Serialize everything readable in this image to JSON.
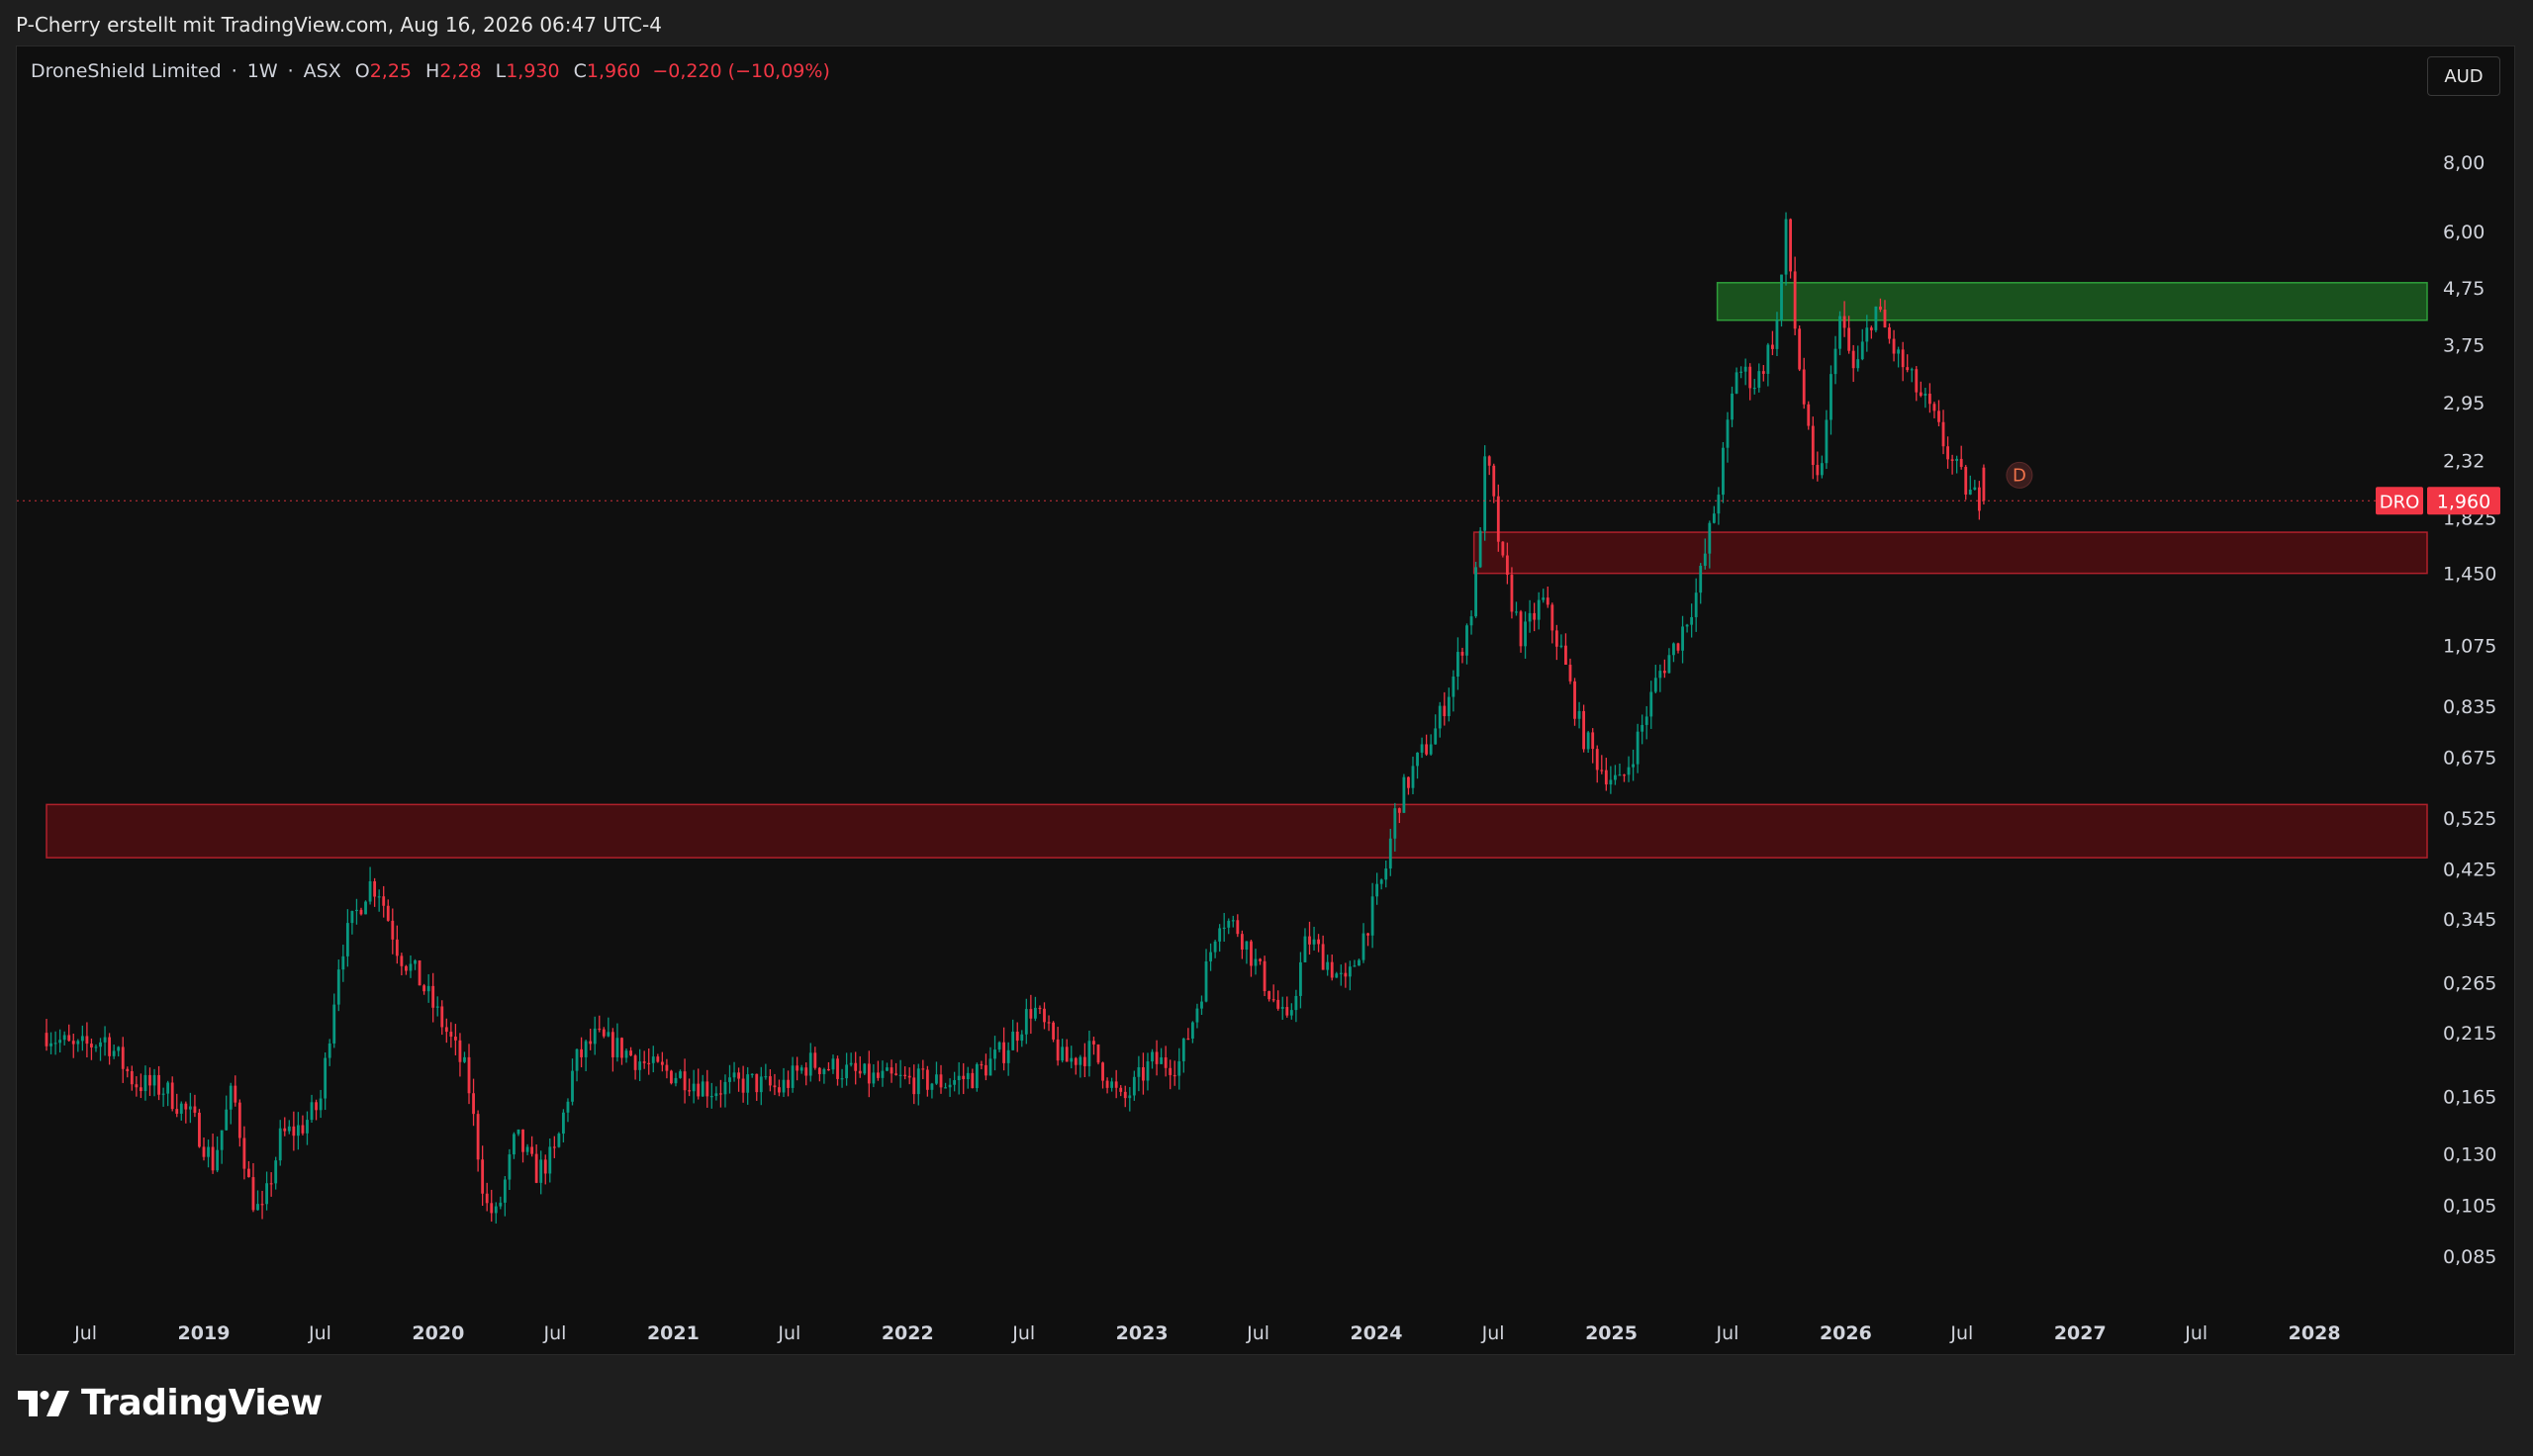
{
  "header": {
    "title": "P-Cherry erstellt mit TradingView.com, Aug 16, 2026 06:47 UTC-4"
  },
  "legend": {
    "symbol_name": "DroneShield Limited",
    "interval": "1W",
    "exchange": "ASX",
    "sep": "·",
    "open_label": "O",
    "open_value": "2,25",
    "high_label": "H",
    "high_value": "2,28",
    "low_label": "L",
    "low_value": "1,930",
    "close_label": "C",
    "close_value": "1,960",
    "change": "−0,220 (−10,09%)"
  },
  "currency_button": "AUD",
  "price_tag": {
    "ticker": "DRO",
    "price": "1,960",
    "color": "#f23645"
  },
  "event_marker": "D",
  "footer": {
    "brand": "TradingView"
  },
  "colors": {
    "up": "#089981",
    "down": "#f23645",
    "background": "#0f0f0f",
    "zone_green": "#1b5e20",
    "zone_red": "#4a0f12"
  },
  "chart_data": {
    "type": "candlestick",
    "scale": "log",
    "y_ticks": [
      "8,00",
      "6,00",
      "4,75",
      "3,75",
      "2,95",
      "2,32",
      "1,825",
      "1,450",
      "1,075",
      "0,835",
      "0,675",
      "0,525",
      "0,425",
      "0,345",
      "0,265",
      "0,215",
      "0,165",
      "0,130",
      "0,105",
      "0,085"
    ],
    "y_tick_values": [
      8.0,
      6.0,
      4.75,
      3.75,
      2.95,
      2.32,
      1.825,
      1.45,
      1.075,
      0.835,
      0.675,
      0.525,
      0.425,
      0.345,
      0.265,
      0.215,
      0.165,
      0.13,
      0.105,
      0.085
    ],
    "x_ticks": [
      {
        "label": "Jul",
        "date": "2018-07-01",
        "bold": false
      },
      {
        "label": "2019",
        "date": "2019-01-01",
        "bold": true
      },
      {
        "label": "Jul",
        "date": "2019-07-01",
        "bold": false
      },
      {
        "label": "2020",
        "date": "2020-01-01",
        "bold": true
      },
      {
        "label": "Jul",
        "date": "2020-07-01",
        "bold": false
      },
      {
        "label": "2021",
        "date": "2021-01-01",
        "bold": true
      },
      {
        "label": "Jul",
        "date": "2021-07-01",
        "bold": false
      },
      {
        "label": "2022",
        "date": "2022-01-01",
        "bold": true
      },
      {
        "label": "Jul",
        "date": "2022-07-01",
        "bold": false
      },
      {
        "label": "2023",
        "date": "2023-01-01",
        "bold": true
      },
      {
        "label": "Jul",
        "date": "2023-07-01",
        "bold": false
      },
      {
        "label": "2024",
        "date": "2024-01-01",
        "bold": true
      },
      {
        "label": "Jul",
        "date": "2024-07-01",
        "bold": false
      },
      {
        "label": "2025",
        "date": "2025-01-01",
        "bold": true
      },
      {
        "label": "Jul",
        "date": "2025-07-01",
        "bold": false
      },
      {
        "label": "2026",
        "date": "2026-01-01",
        "bold": true
      },
      {
        "label": "Jul",
        "date": "2026-07-01",
        "bold": false
      },
      {
        "label": "2027",
        "date": "2027-01-01",
        "bold": true
      },
      {
        "label": "Jul",
        "date": "2027-07-01",
        "bold": false
      },
      {
        "label": "2028",
        "date": "2028-01-01",
        "bold": true
      }
    ],
    "x_range": [
      "2018-05-01",
      "2028-07-01"
    ],
    "zones": [
      {
        "name": "resistance",
        "color": "green",
        "start": "2025-06-15",
        "end": "2028-07-01",
        "low": 4.15,
        "high": 4.85
      },
      {
        "name": "support-upper",
        "color": "red",
        "start": "2024-06-01",
        "end": "2028-07-01",
        "low": 1.45,
        "high": 1.72
      },
      {
        "name": "support-lower",
        "color": "red",
        "start": "2018-05-01",
        "end": "2028-07-01",
        "low": 0.445,
        "high": 0.555
      }
    ],
    "last_price": 1.96,
    "path": [
      [
        "2018-05-01",
        0.215
      ],
      [
        "2018-06-15",
        0.2
      ],
      [
        "2018-08-01",
        0.21
      ],
      [
        "2018-09-15",
        0.175
      ],
      [
        "2018-11-01",
        0.17
      ],
      [
        "2018-12-15",
        0.15
      ],
      [
        "2019-01-15",
        0.125
      ],
      [
        "2019-02-15",
        0.17
      ],
      [
        "2019-03-15",
        0.11
      ],
      [
        "2019-04-01",
        0.1
      ],
      [
        "2019-05-01",
        0.14
      ],
      [
        "2019-06-01",
        0.145
      ],
      [
        "2019-07-01",
        0.16
      ],
      [
        "2019-08-01",
        0.3
      ],
      [
        "2019-09-15",
        0.4
      ],
      [
        "2019-10-01",
        0.39
      ],
      [
        "2019-11-01",
        0.3
      ],
      [
        "2019-12-01",
        0.27
      ],
      [
        "2020-01-15",
        0.215
      ],
      [
        "2020-02-15",
        0.18
      ],
      [
        "2020-03-15",
        0.105
      ],
      [
        "2020-04-01",
        0.1
      ],
      [
        "2020-05-01",
        0.14
      ],
      [
        "2020-06-01",
        0.12
      ],
      [
        "2020-07-01",
        0.13
      ],
      [
        "2020-08-01",
        0.19
      ],
      [
        "2020-09-01",
        0.21
      ],
      [
        "2020-10-15",
        0.2
      ],
      [
        "2020-12-01",
        0.185
      ],
      [
        "2021-01-15",
        0.18
      ],
      [
        "2021-03-01",
        0.17
      ],
      [
        "2021-05-01",
        0.175
      ],
      [
        "2021-06-15",
        0.17
      ],
      [
        "2021-08-01",
        0.19
      ],
      [
        "2021-09-15",
        0.185
      ],
      [
        "2021-11-01",
        0.178
      ],
      [
        "2022-01-01",
        0.176
      ],
      [
        "2022-03-01",
        0.175
      ],
      [
        "2022-04-15",
        0.18
      ],
      [
        "2022-06-01",
        0.2
      ],
      [
        "2022-07-15",
        0.24
      ],
      [
        "2022-09-01",
        0.19
      ],
      [
        "2022-10-15",
        0.2
      ],
      [
        "2022-12-01",
        0.16
      ],
      [
        "2023-01-15",
        0.19
      ],
      [
        "2023-03-01",
        0.19
      ],
      [
        "2023-04-01",
        0.25
      ],
      [
        "2023-05-01",
        0.35
      ],
      [
        "2023-06-01",
        0.33
      ],
      [
        "2023-07-01",
        0.28
      ],
      [
        "2023-08-15",
        0.22
      ],
      [
        "2023-09-15",
        0.32
      ],
      [
        "2023-10-15",
        0.29
      ],
      [
        "2023-11-15",
        0.26
      ],
      [
        "2023-12-15",
        0.33
      ],
      [
        "2024-01-15",
        0.42
      ],
      [
        "2024-02-01",
        0.55
      ],
      [
        "2024-03-01",
        0.65
      ],
      [
        "2024-04-01",
        0.75
      ],
      [
        "2024-05-01",
        0.95
      ],
      [
        "2024-06-01",
        1.3
      ],
      [
        "2024-06-20",
        2.4
      ],
      [
        "2024-07-15",
        1.5
      ],
      [
        "2024-08-15",
        1.1
      ],
      [
        "2024-09-15",
        1.3
      ],
      [
        "2024-10-15",
        1.05
      ],
      [
        "2024-11-15",
        0.75
      ],
      [
        "2024-12-15",
        0.65
      ],
      [
        "2025-01-15",
        0.6
      ],
      [
        "2025-02-15",
        0.75
      ],
      [
        "2025-03-15",
        0.95
      ],
      [
        "2025-04-15",
        1.1
      ],
      [
        "2025-05-15",
        1.35
      ],
      [
        "2025-06-15",
        2.0
      ],
      [
        "2025-07-15",
        3.4
      ],
      [
        "2025-08-15",
        3.2
      ],
      [
        "2025-09-15",
        4.0
      ],
      [
        "2025-10-01",
        6.2
      ],
      [
        "2025-10-15",
        3.9
      ],
      [
        "2025-11-15",
        2.0
      ],
      [
        "2025-12-01",
        2.6
      ],
      [
        "2025-12-20",
        4.3
      ],
      [
        "2026-01-15",
        3.3
      ],
      [
        "2026-02-15",
        4.4
      ],
      [
        "2026-03-15",
        3.7
      ],
      [
        "2026-04-15",
        3.2
      ],
      [
        "2026-05-15",
        2.8
      ],
      [
        "2026-06-15",
        2.3
      ],
      [
        "2026-07-15",
        2.0
      ],
      [
        "2026-08-10",
        1.96
      ]
    ]
  }
}
